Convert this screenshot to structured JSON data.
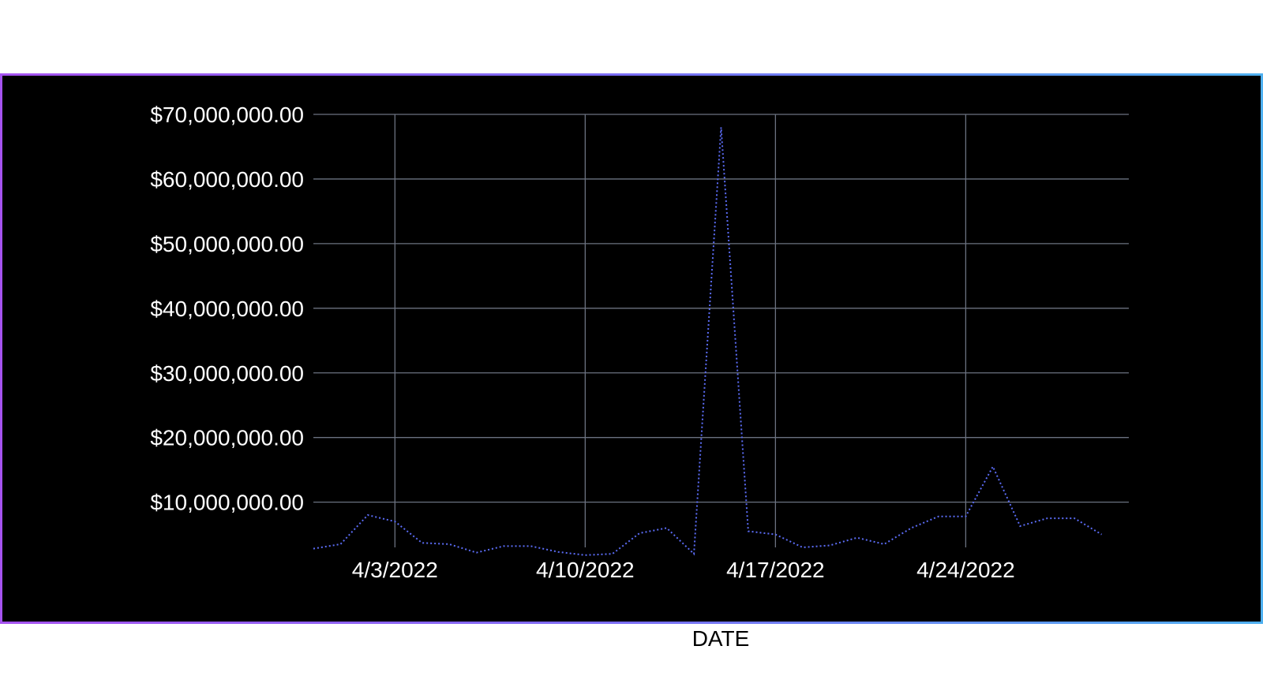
{
  "chart_data": {
    "type": "line",
    "title": "",
    "xlabel": "DATE",
    "ylabel": "",
    "x": [
      "3/31/2022",
      "4/1/2022",
      "4/2/2022",
      "4/3/2022",
      "4/4/2022",
      "4/5/2022",
      "4/6/2022",
      "4/7/2022",
      "4/8/2022",
      "4/9/2022",
      "4/10/2022",
      "4/11/2022",
      "4/12/2022",
      "4/13/2022",
      "4/14/2022",
      "4/15/2022",
      "4/16/2022",
      "4/17/2022",
      "4/18/2022",
      "4/19/2022",
      "4/20/2022",
      "4/21/2022",
      "4/22/2022",
      "4/23/2022",
      "4/24/2022",
      "4/25/2022",
      "4/26/2022",
      "4/27/2022",
      "4/28/2022",
      "4/29/2022",
      "4/30/2022"
    ],
    "series": [
      {
        "color": "#5b6cf5",
        "line_style": "dotted",
        "values": [
          2800000,
          3500000,
          8000000,
          7000000,
          3700000,
          3500000,
          2200000,
          3200000,
          3200000,
          2300000,
          1800000,
          2000000,
          5200000,
          6000000,
          2000000,
          68000000,
          5500000,
          5000000,
          3000000,
          3300000,
          4500000,
          3500000,
          6000000,
          7800000,
          7800000,
          15500000,
          6300000,
          7500000,
          7500000,
          5000000
        ]
      }
    ],
    "x_ticks": [
      "4/3/2022",
      "4/10/2022",
      "4/17/2022",
      "4/24/2022"
    ],
    "y_ticks": [
      "$10,000,000.00",
      "$20,000,000.00",
      "$30,000,000.00",
      "$40,000,000.00",
      "$50,000,000.00",
      "$60,000,000.00",
      "$70,000,000.00"
    ],
    "y_tick_values": [
      10000000,
      20000000,
      30000000,
      40000000,
      50000000,
      60000000,
      70000000
    ],
    "ylim": [
      3000000,
      70000000
    ],
    "grid": true,
    "background": "#000000",
    "grid_color": "#6b7280",
    "text_color": "#ffffff"
  }
}
